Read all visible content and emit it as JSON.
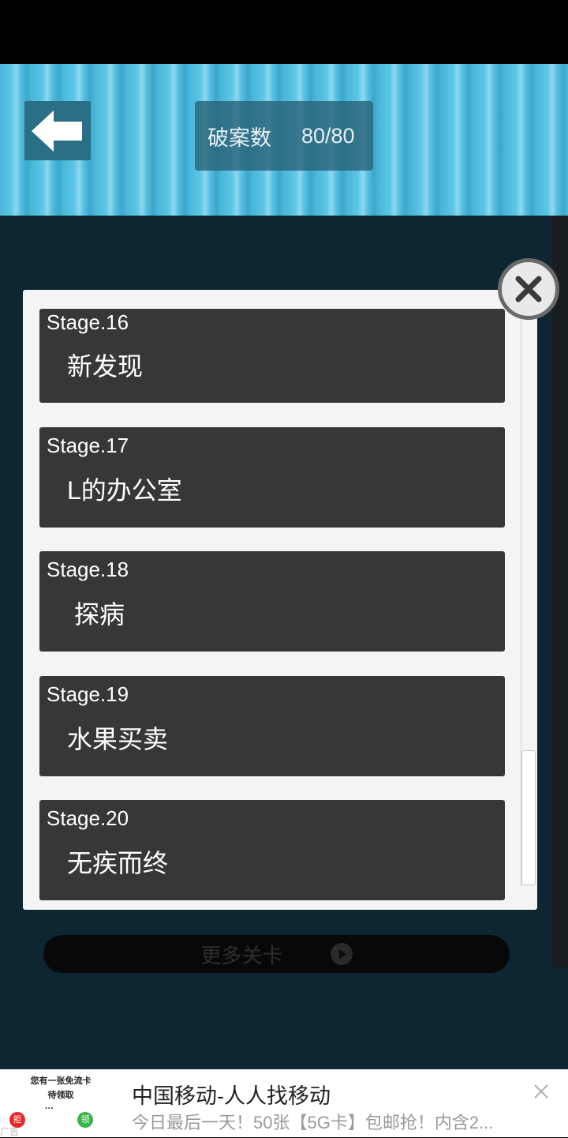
{
  "header": {
    "counter_label": "破案数",
    "counter_value": "80/80"
  },
  "stages": [
    {
      "num": "Stage.16",
      "title": "新发现"
    },
    {
      "num": "Stage.17",
      "title": "L的办公室"
    },
    {
      "num": "Stage.18",
      "title": "探病"
    },
    {
      "num": "Stage.19",
      "title": "水果买卖"
    },
    {
      "num": "Stage.20",
      "title": "无疾而终"
    }
  ],
  "more_stages_label": "更多关卡",
  "ad": {
    "image_line1": "您有一张免流卡",
    "image_line2": "待领取",
    "image_dots": "···",
    "reject_label": "拒",
    "claim_label": "领",
    "tag": "广告",
    "title": "中国移动-人人找移动",
    "description": "今日最后一天！50张【5G卡】包邮抢！内含2..."
  },
  "icons": {
    "back": "back-arrow-icon",
    "close": "close-icon",
    "play": "play-icon",
    "ad_close": "ad-close-icon"
  },
  "colors": {
    "header_accent": "#4ab6d8",
    "card_bg": "#373737",
    "modal_bg": "#f4f4f4"
  }
}
